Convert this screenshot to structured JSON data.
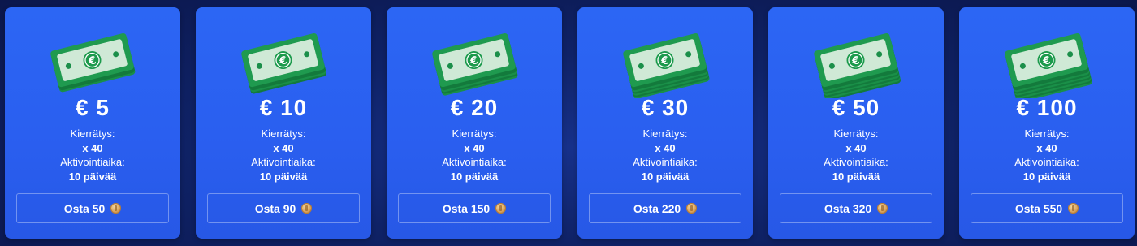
{
  "currency_symbol": "€",
  "colors": {
    "card_bg": "#2c66f4",
    "page_bg": "#0f2266",
    "bill_green": "#1f9a4f",
    "bill_paper": "#cfe9d6",
    "coin": "#d9a25a"
  },
  "cards": [
    {
      "amount": "€ 5",
      "wager_label": "Kierrätys:",
      "wager_value": "x 40",
      "activation_label": "Aktivointiaika:",
      "activation_value": "10 päivää",
      "buy_label": "Osta 50",
      "icon": "cash-stack-icon",
      "coin_icon": "coin-icon"
    },
    {
      "amount": "€ 10",
      "wager_label": "Kierrätys:",
      "wager_value": "x 40",
      "activation_label": "Aktivointiaika:",
      "activation_value": "10 päivää",
      "buy_label": "Osta 90",
      "icon": "cash-stack-icon",
      "coin_icon": "coin-icon"
    },
    {
      "amount": "€ 20",
      "wager_label": "Kierrätys:",
      "wager_value": "x 40",
      "activation_label": "Aktivointiaika:",
      "activation_value": "10 päivää",
      "buy_label": "Osta 150",
      "icon": "cash-stack-icon",
      "coin_icon": "coin-icon"
    },
    {
      "amount": "€ 30",
      "wager_label": "Kierrätys:",
      "wager_value": "x 40",
      "activation_label": "Aktivointiaika:",
      "activation_value": "10 päivää",
      "buy_label": "Osta 220",
      "icon": "cash-stack-icon",
      "coin_icon": "coin-icon"
    },
    {
      "amount": "€ 50",
      "wager_label": "Kierrätys:",
      "wager_value": "x 40",
      "activation_label": "Aktivointiaika:",
      "activation_value": "10 päivää",
      "buy_label": "Osta 320",
      "icon": "cash-stack-icon",
      "coin_icon": "coin-icon"
    },
    {
      "amount": "€ 100",
      "wager_label": "Kierrätys:",
      "wager_value": "x 40",
      "activation_label": "Aktivointiaika:",
      "activation_value": "10 päivää",
      "buy_label": "Osta 550",
      "icon": "cash-stack-icon",
      "coin_icon": "coin-icon"
    }
  ]
}
